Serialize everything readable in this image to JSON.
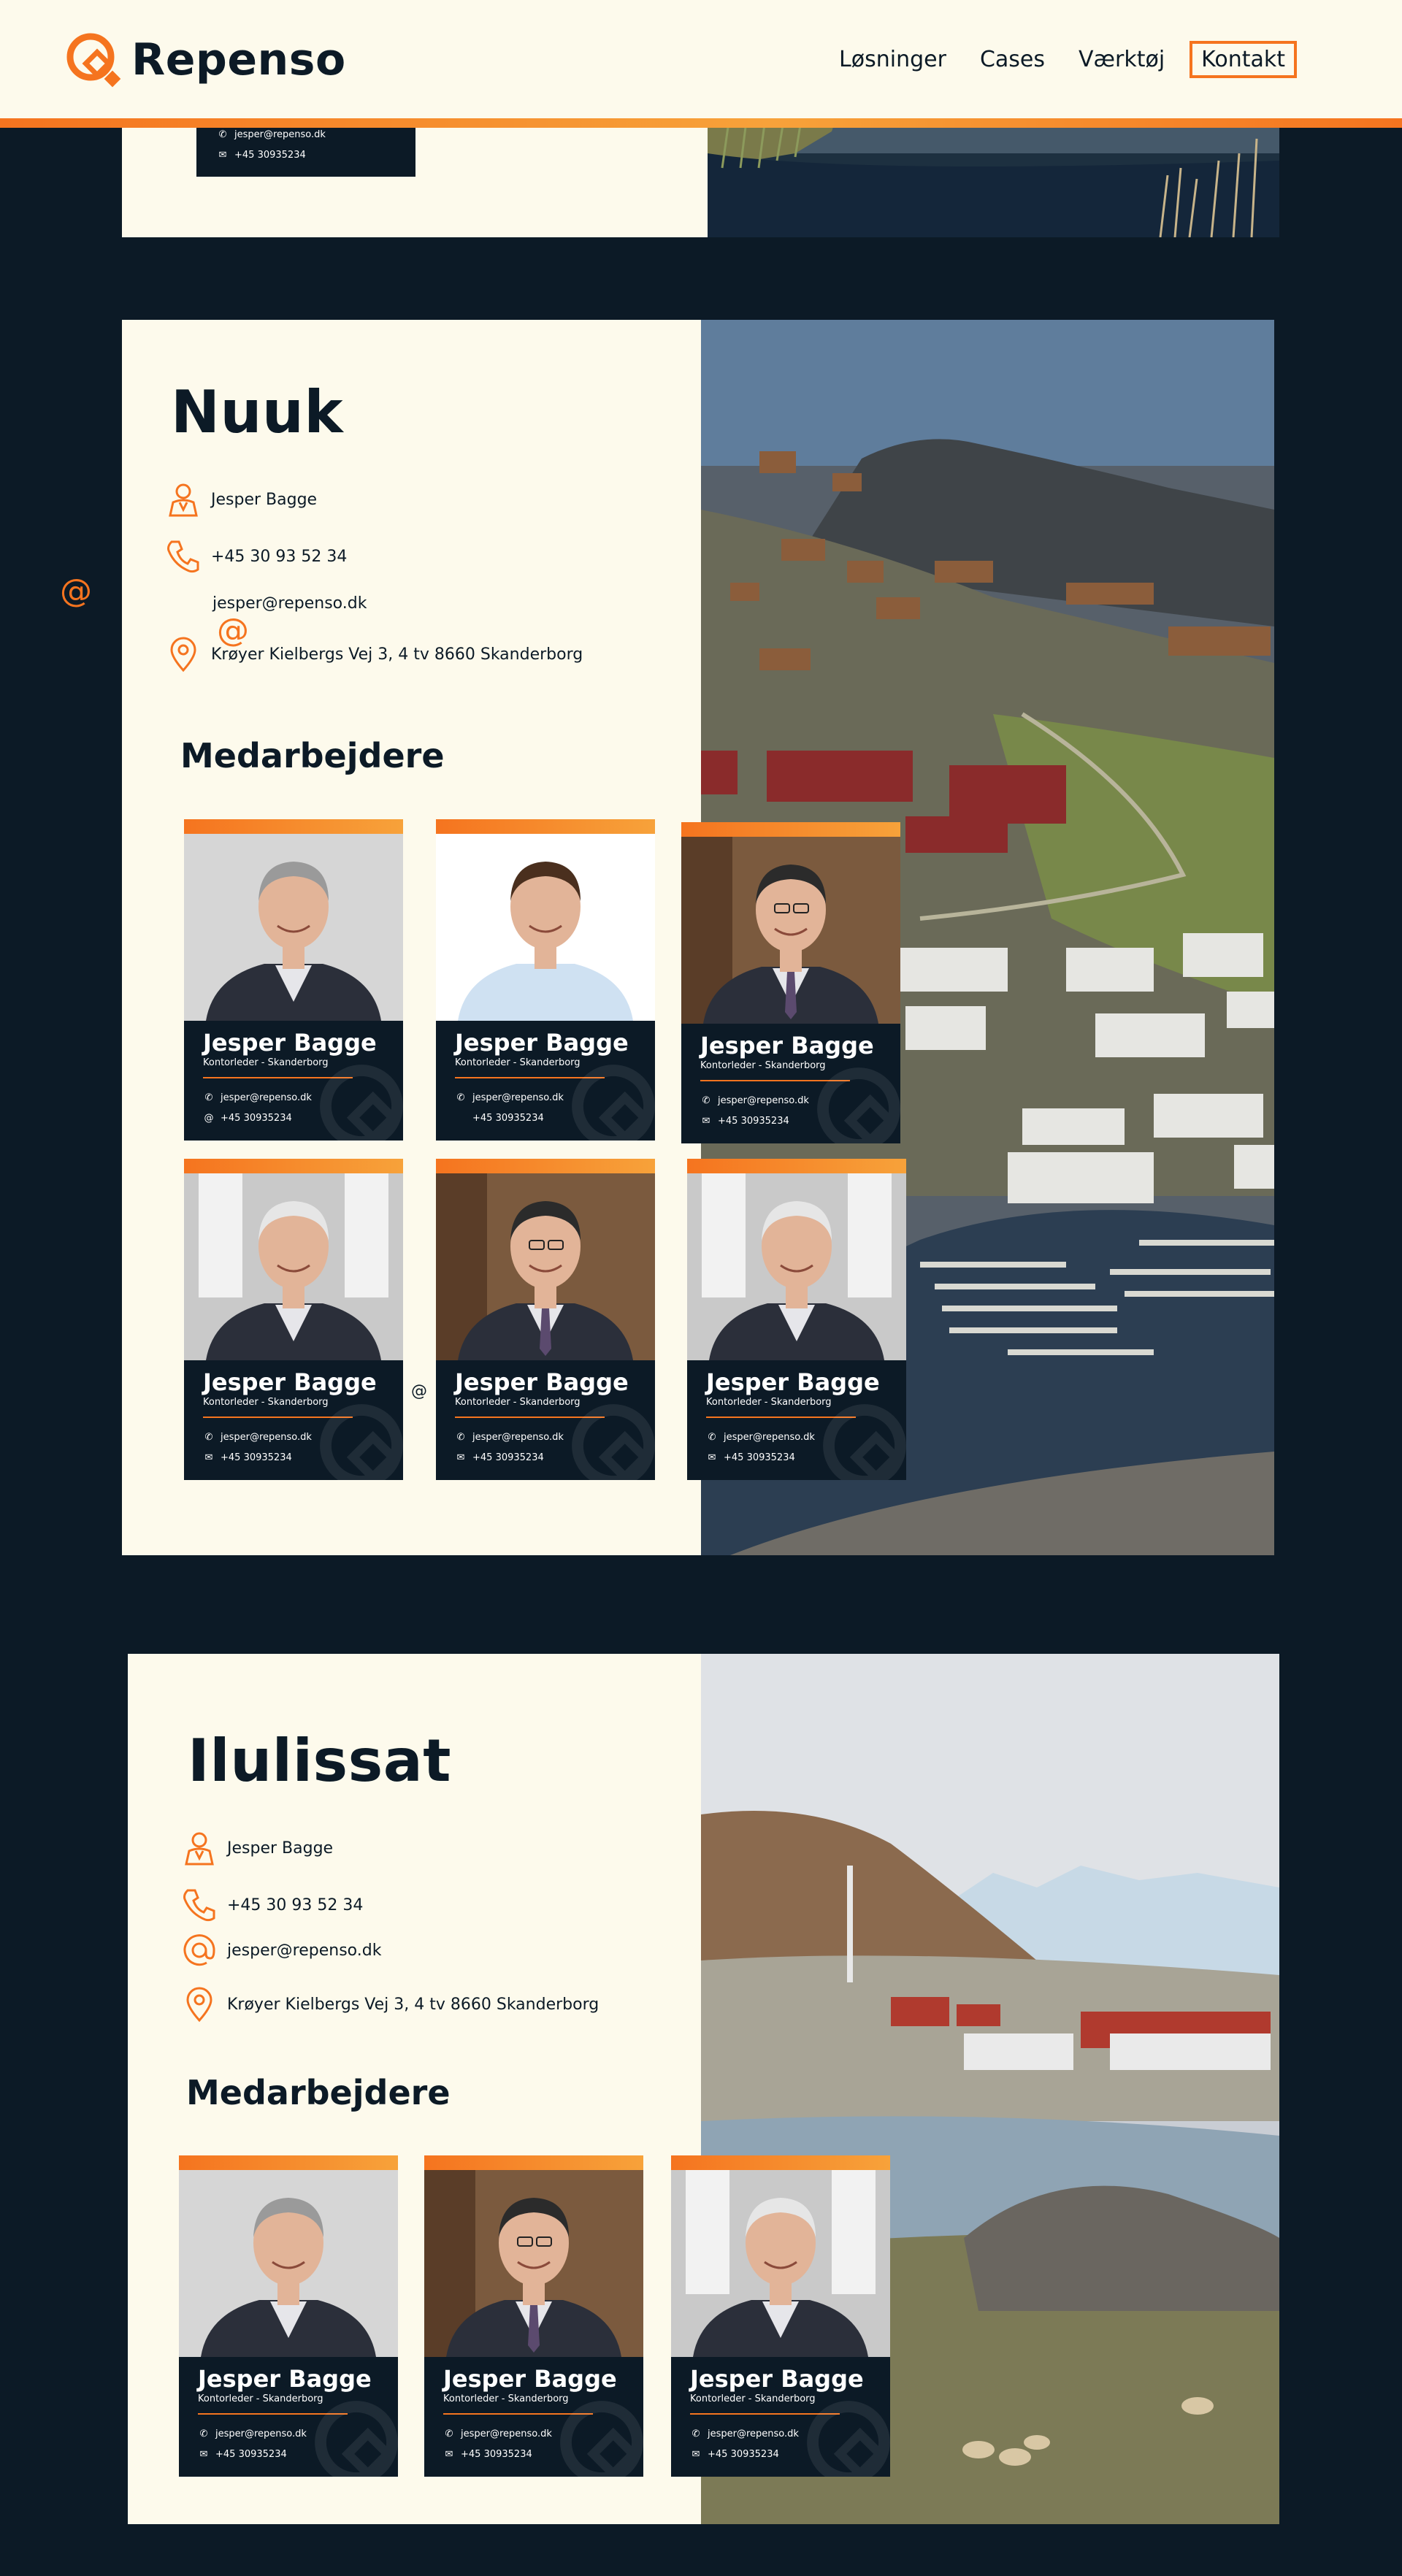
{
  "header": {
    "brand": "Repenso",
    "nav": [
      "Løsninger",
      "Cases",
      "Værktøj"
    ],
    "contact": "Kontakt"
  },
  "top_card": {
    "email": "jesper@repenso.dk",
    "phone": "+45 30935234"
  },
  "nuuk": {
    "title": "Nuuk",
    "contact_name": "Jesper Bagge",
    "phone": "+45 30 93 52 34",
    "email": "jesper@repenso.dk",
    "address": "Krøyer Kielbergs Vej 3, 4 tv 8660 Skanderborg",
    "staff_title": "Medarbejdere",
    "employees": [
      {
        "name": "Jesper Bagge",
        "role": "Kontorleder - Skanderborg",
        "email": "jesper@repenso.dk",
        "phone": "+45 30935234",
        "email_icon": "phone-icon",
        "phone_icon": "at-icon"
      },
      {
        "name": "Jesper Bagge",
        "role": "Kontorleder - Skanderborg",
        "email": "jesper@repenso.dk",
        "phone": "+45 30935234",
        "email_icon": "phone-icon",
        "phone_icon": "none"
      },
      {
        "name": "Jesper Bagge",
        "role": "Kontorleder - Skanderborg",
        "email": "jesper@repenso.dk",
        "phone": "+45 30935234",
        "email_icon": "phone-icon",
        "phone_icon": "envelope-icon"
      },
      {
        "name": "Jesper Bagge",
        "role": "Kontorleder - Skanderborg",
        "email": "jesper@repenso.dk",
        "phone": "+45 30935234",
        "email_icon": "phone-icon",
        "phone_icon": "envelope-icon"
      },
      {
        "name": "Jesper Bagge",
        "role": "Kontorleder - Skanderborg",
        "email": "jesper@repenso.dk",
        "phone": "+45 30935234",
        "email_icon": "phone-icon",
        "phone_icon": "envelope-icon"
      },
      {
        "name": "Jesper Bagge",
        "role": "Kontorleder - Skanderborg",
        "email": "jesper@repenso.dk",
        "phone": "+45 30935234",
        "email_icon": "phone-icon",
        "phone_icon": "envelope-icon"
      }
    ],
    "stray_at": "@"
  },
  "ilulissat": {
    "title": "Ilulissat",
    "contact_name": "Jesper Bagge",
    "phone": "+45 30 93 52 34",
    "email": "jesper@repenso.dk",
    "address": "Krøyer Kielbergs Vej 3, 4 tv 8660 Skanderborg",
    "staff_title": "Medarbejdere",
    "employees": [
      {
        "name": "Jesper Bagge",
        "role": "Kontorleder - Skanderborg",
        "email": "jesper@repenso.dk",
        "phone": "+45 30935234"
      },
      {
        "name": "Jesper Bagge",
        "role": "Kontorleder - Skanderborg",
        "email": "jesper@repenso.dk",
        "phone": "+45 30935234"
      },
      {
        "name": "Jesper Bagge",
        "role": "Kontorleder - Skanderborg",
        "email": "jesper@repenso.dk",
        "phone": "+45 30935234"
      }
    ]
  },
  "colors": {
    "navy": "#0c1a26",
    "cream": "#fdfaec",
    "orange": "#f5741f"
  }
}
